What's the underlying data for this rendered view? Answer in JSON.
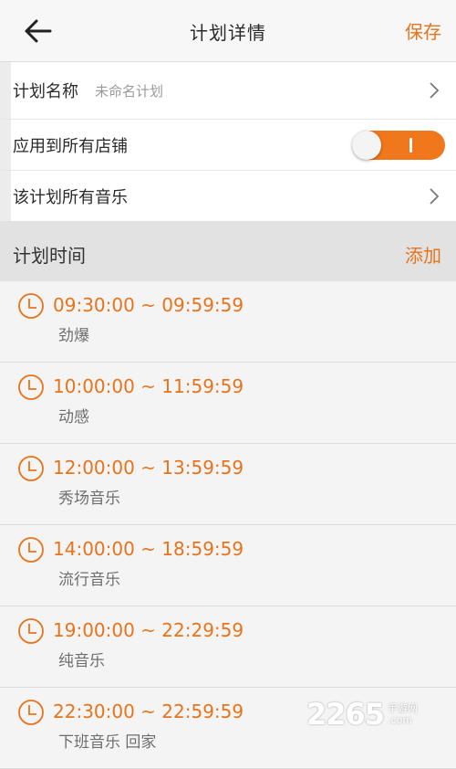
{
  "header": {
    "title": "计划详情",
    "save_label": "保存"
  },
  "settings": {
    "plan_name_label": "计划名称",
    "plan_name_value": "未命名计划",
    "apply_all_stores_label": "应用到所有店铺",
    "apply_all_stores_on": true,
    "all_music_label": "该计划所有音乐"
  },
  "section": {
    "title": "计划时间",
    "add_label": "添加"
  },
  "schedule": [
    {
      "time": "09:30:00 ~ 09:59:59",
      "name": "劲爆"
    },
    {
      "time": "10:00:00 ~ 11:59:59",
      "name": "动感"
    },
    {
      "time": "12:00:00 ~ 13:59:59",
      "name": "秀场音乐"
    },
    {
      "time": "14:00:00 ~ 18:59:59",
      "name": "流行音乐"
    },
    {
      "time": "19:00:00 ~ 22:29:59",
      "name": "纯音乐"
    },
    {
      "time": "22:30:00 ~ 22:59:59",
      "name": "下班音乐 回家"
    }
  ],
  "watermark": {
    "number": "2265",
    "sub": ".com",
    "text": "手游网"
  },
  "colors": {
    "accent": "#e7731b",
    "toggle_on": "#f0771c"
  }
}
